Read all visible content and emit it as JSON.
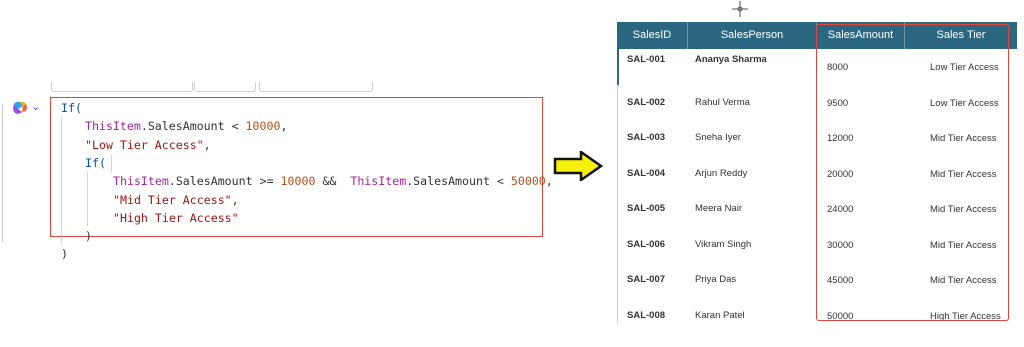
{
  "formula": {
    "lines": [
      {
        "indent": 0,
        "parts": [
          {
            "t": "If(",
            "c": "kw"
          }
        ]
      },
      {
        "indent": 1,
        "parts": [
          {
            "t": "ThisItem",
            "c": "prop"
          },
          {
            "t": ".SalesAmount < ",
            "c": "op"
          },
          {
            "t": "10000",
            "c": "num"
          },
          {
            "t": ",",
            "c": "op"
          }
        ]
      },
      {
        "indent": 1,
        "parts": [
          {
            "t": "\"Low Tier Access\"",
            "c": "str"
          },
          {
            "t": ",",
            "c": "op"
          }
        ]
      },
      {
        "indent": 1,
        "parts": [
          {
            "t": "If(",
            "c": "kw"
          }
        ]
      },
      {
        "indent": 2,
        "parts": [
          {
            "t": "ThisItem",
            "c": "prop"
          },
          {
            "t": ".SalesAmount >= ",
            "c": "op"
          },
          {
            "t": "10000",
            "c": "num"
          },
          {
            "t": " &&  ",
            "c": "op"
          },
          {
            "t": "ThisItem",
            "c": "prop"
          },
          {
            "t": ".SalesAmount < ",
            "c": "op"
          },
          {
            "t": "50000",
            "c": "num"
          },
          {
            "t": ",",
            "c": "op"
          }
        ]
      },
      {
        "indent": 2,
        "parts": [
          {
            "t": "\"Mid Tier Access\"",
            "c": "str"
          },
          {
            "t": ",",
            "c": "op"
          }
        ]
      },
      {
        "indent": 2,
        "parts": [
          {
            "t": "\"High Tier Access\"",
            "c": "str"
          }
        ]
      },
      {
        "indent": 1,
        "parts": [
          {
            "t": ")",
            "c": "op"
          }
        ]
      },
      {
        "indent": 0,
        "parts": [
          {
            "t": ")",
            "c": "op"
          }
        ]
      }
    ]
  },
  "colors": {
    "header_bg": "#2b6780",
    "highlight_border": "#e0443c",
    "arrow_fill": "#f5f10a"
  },
  "icons": {
    "copilot": "copilot-icon",
    "dropdown": "chevron-down-icon",
    "arrow": "arrow-right-icon",
    "crosshair": "crosshair-icon"
  },
  "table": {
    "columns": [
      "SalesID",
      "SalesPerson",
      "SalesAmount",
      "Sales Tier"
    ],
    "rows": [
      [
        "SAL-001",
        "Ananya Sharma",
        "8000",
        "Low Tier Access"
      ],
      [
        "SAL-002",
        "Rahul Verma",
        "9500",
        "Low Tier Access"
      ],
      [
        "SAL-003",
        "Sneha Iyer",
        "12000",
        "Mid Tier Access"
      ],
      [
        "SAL-004",
        "Arjun Reddy",
        "20000",
        "Mid Tier Access"
      ],
      [
        "SAL-005",
        "Meera Nair",
        "24000",
        "Mid Tier Access"
      ],
      [
        "SAL-006",
        "Vikram Singh",
        "30000",
        "Mid Tier Access"
      ],
      [
        "SAL-007",
        "Priya Das",
        "45000",
        "Mid Tier Access"
      ],
      [
        "SAL-008",
        "Karan Patel",
        "50000",
        "High Tier Access"
      ]
    ],
    "selected_row": 0
  }
}
